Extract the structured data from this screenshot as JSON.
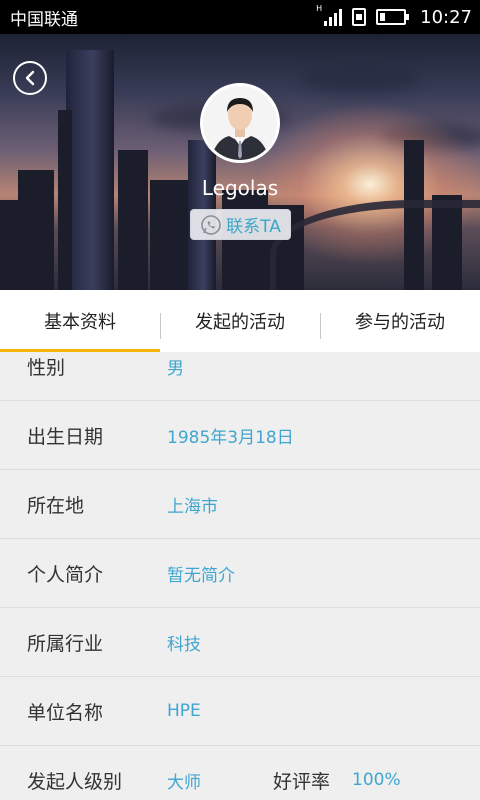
{
  "status_bar": {
    "carrier": "中国联通",
    "network": "H",
    "time": "10:27"
  },
  "profile": {
    "username": "Legolas",
    "contact_label": "联系TA"
  },
  "tabs": [
    {
      "label": "基本资料",
      "active": true
    },
    {
      "label": "发起的活动",
      "active": false
    },
    {
      "label": "参与的活动",
      "active": false
    }
  ],
  "info": {
    "gender": {
      "label": "性别",
      "value": "男"
    },
    "birthday": {
      "label": "出生日期",
      "value": "1985年3月18日"
    },
    "location": {
      "label": "所在地",
      "value": "上海市"
    },
    "bio": {
      "label": "个人简介",
      "value": "暂无简介"
    },
    "industry": {
      "label": "所属行业",
      "value": "科技"
    },
    "company": {
      "label": "单位名称",
      "value": "HPE"
    },
    "level": {
      "label": "发起人级别",
      "value": "大师"
    },
    "rating": {
      "label": "好评率",
      "value": "100%"
    }
  },
  "colors": {
    "accent": "#f5b400",
    "value_text": "#41a6cf",
    "background": "#efefef"
  }
}
